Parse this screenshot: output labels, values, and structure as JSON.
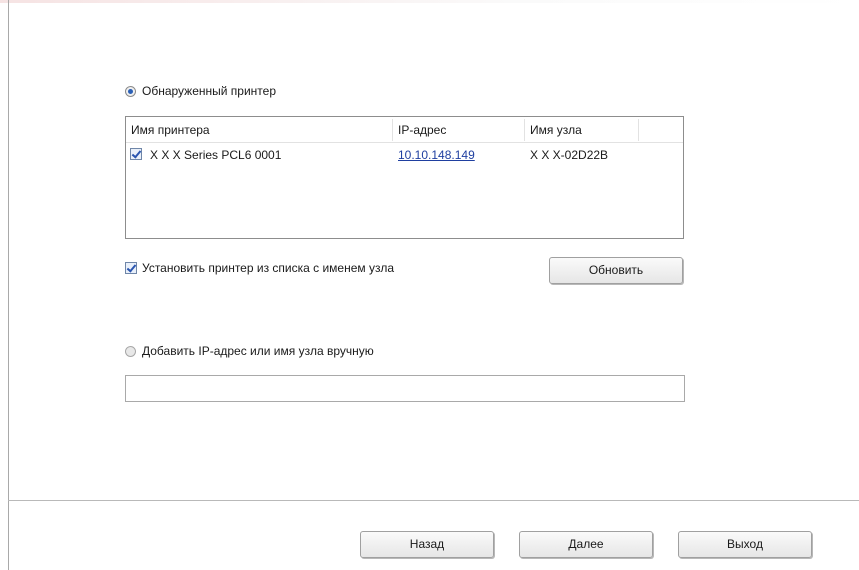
{
  "detected": {
    "radio_label": "Обнаруженный принтер",
    "selected": true
  },
  "printer_table": {
    "columns": [
      "Имя принтера",
      "IP-адрес",
      "Имя узла"
    ],
    "rows": [
      {
        "checked": true,
        "name": "X X X  Series PCL6 0001",
        "ip": "10.10.148.149",
        "host": "X X X-02D22B"
      }
    ]
  },
  "install_by_host": {
    "label": "Установить принтер из списка с именем узла",
    "checked": true
  },
  "refresh_button": "Обновить",
  "manual": {
    "radio_label": "Добавить IP-адрес или имя узла вручную",
    "selected": false,
    "input_value": ""
  },
  "footer": {
    "back_label": "Назад",
    "next_label": "Далее",
    "exit_label": "Выход"
  },
  "colors": {
    "link": "#1f3fa0",
    "radio_accent": "#2a5fb5"
  }
}
